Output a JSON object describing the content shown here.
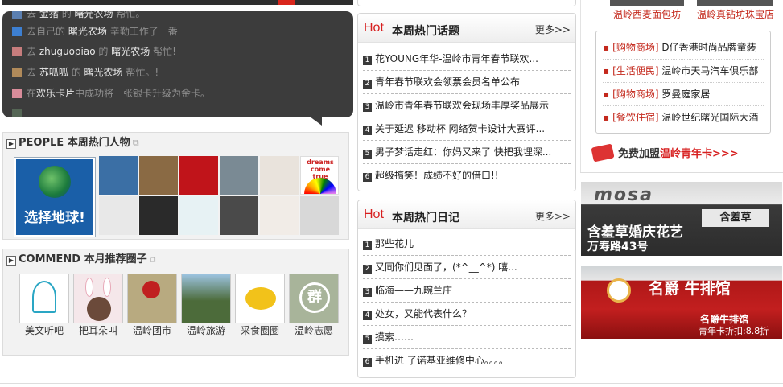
{
  "feed": {
    "items": [
      {
        "pre": "去",
        "user": "zhuguopiao",
        "mid": "的",
        "place": "曙光农场",
        "post": "帮忙!",
        "avatar_color": "#c77d7d"
      },
      {
        "pre": "去",
        "user": "苏呱呱",
        "mid": "的",
        "place": "曙光农场",
        "post": "帮忙。!",
        "avatar_color": "#b08a5a"
      }
    ],
    "item_partial_top": {
      "pre": "去",
      "user": "金猪",
      "mid": "的",
      "place": "曙光农场",
      "post": "帮忙。"
    },
    "item_own": {
      "pre": "去自己的",
      "place": "曙光农场",
      "post": "辛勤工作了一番"
    },
    "item_card": {
      "pre": "在",
      "place": "欢乐卡片",
      "post": "中成功将一张银卡升级为金卡。"
    }
  },
  "people": {
    "title_en": "PEOPLE",
    "title_cn": "本周热门人物",
    "globe_label": "选择地球!",
    "avatar_colors": [
      "#3b6fa5",
      "#8a6a44",
      "#c0141a",
      "#7a8a94",
      "#e9e3dc",
      "#ffffff",
      "#e8e8e8",
      "#2a2a2a",
      "#e7f2f4",
      "#4a4a4a",
      "#f1ece7",
      "#d8d8d8"
    ],
    "dreams_label": "dreams come true"
  },
  "commend": {
    "title_en": "COMMEND",
    "title_cn": "本月推荐圈子",
    "circles": [
      {
        "label": "美文听吧",
        "color": "#ffffff"
      },
      {
        "label": "把耳朵叫",
        "color": "#f5e7ea"
      },
      {
        "label": "温岭团市",
        "color": "#b8aa80"
      },
      {
        "label": "温岭旅游",
        "color": "#4c6b3a"
      },
      {
        "label": "采食圈圈",
        "color": "#f3e6b8"
      },
      {
        "label": "温岭志愿",
        "color": "#a8b49a"
      }
    ]
  },
  "topics": {
    "hot": "Hot",
    "title": "本周热门话题",
    "more": "更多>>",
    "items": [
      "花YOUNG年华-温岭市青年春节联欢...",
      "青年春节联欢会领票会员名单公布",
      "温岭市青年春节联欢会现场丰厚奖品展示",
      "关于延迟 移动杯 网络贺卡设计大赛评...",
      "男子梦话走红：你妈又来了 快把我埋深...",
      "超级搞笑！成绩不好的借口!!"
    ]
  },
  "diary": {
    "hot": "Hot",
    "title": "本周热门日记",
    "more": "更多>>",
    "items": [
      "那些花儿",
      "又同你们见面了，(*^__^*) 嘻...",
      "临海——九畹兰庄",
      "处女，又能代表什么？",
      "摸索……",
      "手机进 了诺基亚维修中心。。。。"
    ]
  },
  "shops": [
    {
      "label": "温岭西麦面包坊"
    },
    {
      "label": "温岭真钻坊珠宝店"
    }
  ],
  "categories": [
    {
      "tag": "[购物商场]",
      "text": "D仔香港时尚品牌童装"
    },
    {
      "tag": "[生活便民]",
      "text": "温岭市天马汽车俱乐部"
    },
    {
      "tag": "[购物商场]",
      "text": "罗曼庭家居"
    },
    {
      "tag": "[餐饮住宿]",
      "text": "温岭世纪曙光国际大酒"
    }
  ],
  "join": {
    "pre": "免费加盟",
    "highlight": "温岭青年卡>>>"
  },
  "ads": [
    {
      "sign": "含羞草",
      "line1": "含羞草婚庆花艺",
      "line2": "万寿路43号"
    },
    {
      "sign": "名爵 牛排馆",
      "line1": "名爵牛排馆",
      "line2": "青年卡折扣:8.8折"
    }
  ],
  "colors": {
    "accent_red": "#d71f1f",
    "link_red": "#c4281c",
    "feed_bg": "#3c3c3c"
  }
}
